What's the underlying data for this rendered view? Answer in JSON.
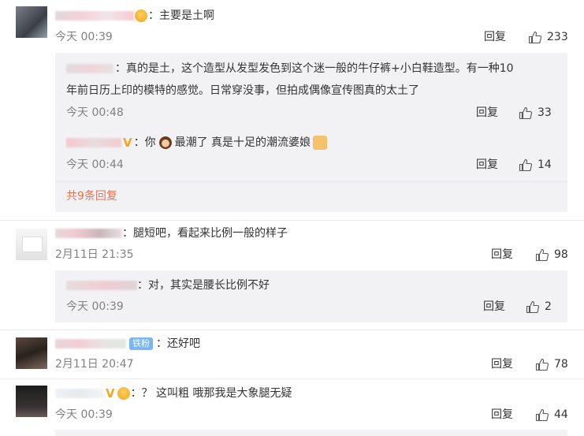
{
  "comments": [
    {
      "text": "：主要是土啊",
      "time": "今天 00:39",
      "reply_label": "回复",
      "likes": "233",
      "replies": [
        {
          "text": "：真的是土，这个造型从发型发色到这个迷一般的牛仔裤+小白鞋造型。有一种10",
          "text2": "年前日历上印的模特的感觉。日常穿没事，但拍成偶像宣传图真的太土了",
          "time": "今天 00:48",
          "reply_label": "回复",
          "likes": "33"
        },
        {
          "text_pre": "：你",
          "text_post": "最潮了 真是十足的潮流婆娘",
          "time": "今天 00:44",
          "reply_label": "回复",
          "likes": "14"
        }
      ],
      "more_replies": "共9条回复"
    },
    {
      "text": "：腿短吧，看起来比例一般的样子",
      "time": "2月11日 21:35",
      "reply_label": "回复",
      "likes": "98",
      "replies": [
        {
          "text": "：对，其实是腰长比例不好",
          "time": "今天 00:39",
          "reply_label": "回复",
          "likes": "2"
        }
      ]
    },
    {
      "badge": "铁粉",
      "text": "：还好吧",
      "time": "2月11日 20:47",
      "reply_label": "回复",
      "likes": "78"
    },
    {
      "text": "：？ 这叫粗 哦那我是大象腿无疑",
      "time": "今天 00:39",
      "reply_label": "回复",
      "likes": "44"
    }
  ],
  "colors": {
    "more_link": "#eb7350",
    "meta": "#808080",
    "sub_bg": "#f2f2f5",
    "fan_badge": "#7ab6f0",
    "verified": "#f5a623"
  },
  "icons": [
    "thumbs-up-icon",
    "laugh-emoji-icon",
    "girl-emoji-icon",
    "thumbs-up-emoji-icon",
    "verified-v-icon",
    "heart-eyes-emoji-icon"
  ]
}
